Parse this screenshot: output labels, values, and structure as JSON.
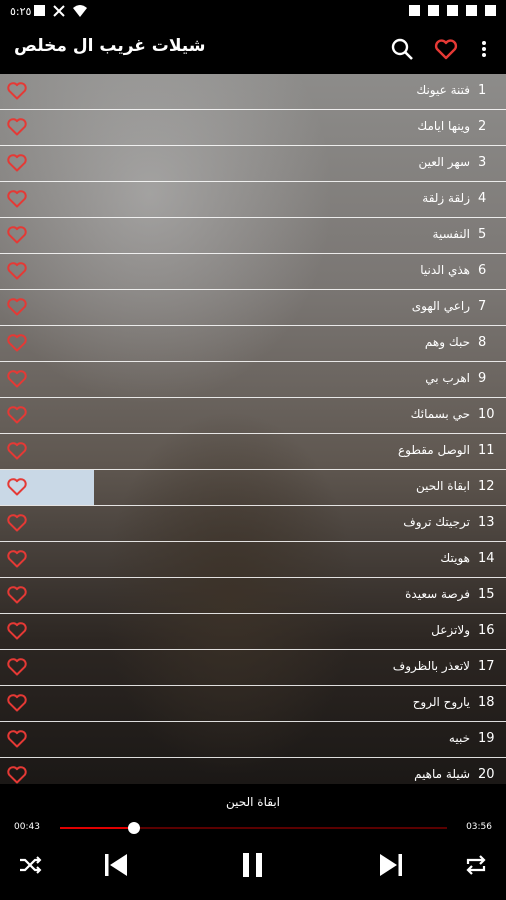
{
  "status": {
    "time": "٥:٢٥"
  },
  "appbar": {
    "title": "شيلات غريب ال مخلص",
    "icons": [
      "search-icon",
      "heart-icon",
      "more-vert-icon"
    ],
    "accent": "#e53935"
  },
  "songs": [
    {
      "num": "1",
      "name": "فتنة عيونك"
    },
    {
      "num": "2",
      "name": "وينها ايامك"
    },
    {
      "num": "3",
      "name": "سهر العين"
    },
    {
      "num": "4",
      "name": "زلقة زلقة"
    },
    {
      "num": "5",
      "name": "النفسية"
    },
    {
      "num": "6",
      "name": "هذي الدنيا"
    },
    {
      "num": "7",
      "name": "راعي الهوى"
    },
    {
      "num": "8",
      "name": "حبك وهم"
    },
    {
      "num": "9",
      "name": "اهرب بي"
    },
    {
      "num": "10",
      "name": "حي بسمائك"
    },
    {
      "num": "11",
      "name": "الوصل مقطوع"
    },
    {
      "num": "12",
      "name": "ابقاة الحين"
    },
    {
      "num": "13",
      "name": "ترجيتك تروف"
    },
    {
      "num": "14",
      "name": "هويتك"
    },
    {
      "num": "15",
      "name": "فرصة سعيدة"
    },
    {
      "num": "16",
      "name": "ولاتزعل"
    },
    {
      "num": "17",
      "name": "لاتعذر بالظروف"
    },
    {
      "num": "18",
      "name": "ياروح الروح"
    },
    {
      "num": "19",
      "name": "خبيه"
    },
    {
      "num": "20",
      "name": "شيلة ماهيم"
    }
  ],
  "player": {
    "now_playing": "ابقاة الحين",
    "elapsed": "00:43",
    "duration": "03:56",
    "progress": 0.19,
    "controls": [
      "shuffle-icon",
      "previous-icon",
      "pause-icon",
      "next-icon",
      "repeat-icon"
    ]
  }
}
